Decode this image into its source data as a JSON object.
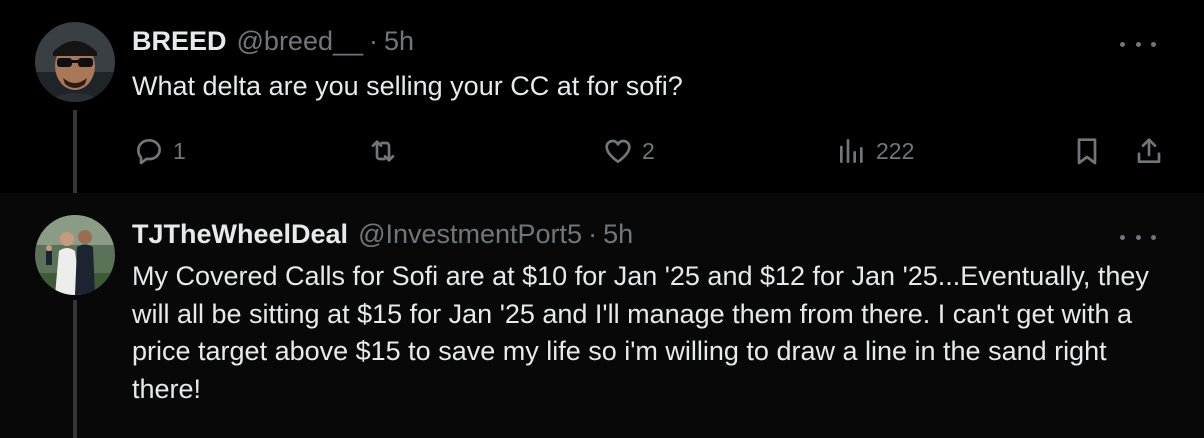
{
  "tweets": [
    {
      "author_name": "BREED",
      "handle": "@breed__",
      "separator": "·",
      "time": "5h",
      "text": "What delta are you selling your CC at for sofi?",
      "actions": {
        "replies": "1",
        "reposts": "",
        "likes": "2",
        "views": "222"
      }
    },
    {
      "author_name": "TJTheWheelDeal",
      "handle": "@InvestmentPort5",
      "separator": "·",
      "time": "5h",
      "text": "My Covered Calls for Sofi are at $10 for Jan '25 and $12 for Jan '25...Eventually, they will all be sitting at $15 for Jan '25 and I'll manage them from there.  I can't get with a price target above $15 to save my life so i'm willing to draw a line in the sand right there!"
    }
  ],
  "colors": {
    "background": "#000000",
    "reply_background": "#080808",
    "text_primary": "#e7e9ea",
    "text_secondary": "#71767b",
    "thread_line": "#333639"
  }
}
